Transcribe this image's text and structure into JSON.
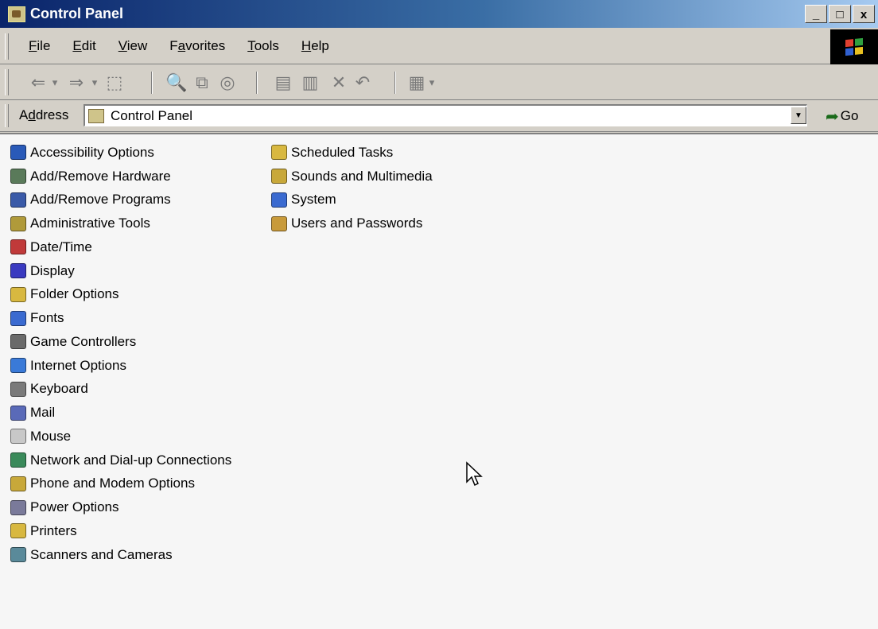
{
  "window": {
    "title": "Control Panel",
    "buttons": {
      "minimize": "_",
      "maximize": "□",
      "close": "x"
    }
  },
  "menubar": {
    "items": [
      {
        "label": "File",
        "accel": "F",
        "rest": "ile"
      },
      {
        "label": "Edit",
        "accel": "E",
        "rest": "dit"
      },
      {
        "label": "View",
        "accel": "V",
        "rest": "iew"
      },
      {
        "label": "Favorites",
        "pre": "F",
        "accel": "a",
        "rest": "vorites"
      },
      {
        "label": "Tools",
        "accel": "T",
        "rest": "ools"
      },
      {
        "label": "Help",
        "accel": "H",
        "rest": "elp"
      }
    ]
  },
  "toolbar": {
    "buttons": [
      {
        "name": "back-icon",
        "glyph": "⇐"
      },
      {
        "name": "back-dropdown-icon",
        "glyph": "▾"
      },
      {
        "name": "forward-icon",
        "glyph": "⇒"
      },
      {
        "name": "forward-dropdown-icon",
        "glyph": "▾"
      },
      {
        "name": "up-folder-icon",
        "glyph": "⬚"
      },
      {
        "name": "search-icon",
        "glyph": "🔍"
      },
      {
        "name": "folders-icon",
        "glyph": "⧉"
      },
      {
        "name": "history-icon",
        "glyph": "◎"
      },
      {
        "name": "move-to-icon",
        "glyph": "▤"
      },
      {
        "name": "copy-to-icon",
        "glyph": "▥"
      },
      {
        "name": "delete-icon",
        "glyph": "✕"
      },
      {
        "name": "undo-icon",
        "glyph": "↶"
      },
      {
        "name": "views-icon",
        "glyph": "▦"
      },
      {
        "name": "views-dropdown-icon",
        "glyph": "▾"
      }
    ]
  },
  "address": {
    "label_pre": "A",
    "label_accel": "d",
    "label_rest": "dress",
    "value": "Control Panel",
    "go_label": "Go"
  },
  "items_col1": [
    {
      "label": "Accessibility Options",
      "icon": "accessibility-icon",
      "color": "#2a5ab8"
    },
    {
      "label": "Add/Remove Hardware",
      "icon": "hardware-icon",
      "color": "#5a7a5a"
    },
    {
      "label": "Add/Remove Programs",
      "icon": "programs-icon",
      "color": "#3a5aa8"
    },
    {
      "label": "Administrative Tools",
      "icon": "admin-tools-icon",
      "color": "#b09a3a"
    },
    {
      "label": "Date/Time",
      "icon": "calendar-clock-icon",
      "color": "#c03a3a"
    },
    {
      "label": "Display",
      "icon": "display-icon",
      "color": "#3a3ac0"
    },
    {
      "label": "Folder Options",
      "icon": "folder-options-icon",
      "color": "#d8b840"
    },
    {
      "label": "Fonts",
      "icon": "fonts-icon",
      "color": "#3a6ad0"
    },
    {
      "label": "Game Controllers",
      "icon": "joystick-icon",
      "color": "#6a6a6a"
    },
    {
      "label": "Internet Options",
      "icon": "globe-icon",
      "color": "#3a7ad8"
    },
    {
      "label": "Keyboard",
      "icon": "keyboard-icon",
      "color": "#7a7a7a"
    },
    {
      "label": "Mail",
      "icon": "mail-icon",
      "color": "#5a6ab8"
    },
    {
      "label": "Mouse",
      "icon": "mouse-icon",
      "color": "#c8c8c8"
    },
    {
      "label": "Network and Dial-up Connections",
      "icon": "network-icon",
      "color": "#3a8a5a"
    },
    {
      "label": "Phone and Modem Options",
      "icon": "phone-icon",
      "color": "#c8a83a"
    },
    {
      "label": "Power Options",
      "icon": "power-icon",
      "color": "#7a7a9a"
    },
    {
      "label": "Printers",
      "icon": "printer-folder-icon",
      "color": "#d8b840"
    },
    {
      "label": "Scanners and Cameras",
      "icon": "scanner-icon",
      "color": "#5a8a9a"
    }
  ],
  "items_col2": [
    {
      "label": "Scheduled Tasks",
      "icon": "scheduled-tasks-icon",
      "color": "#d8b840"
    },
    {
      "label": "Sounds and Multimedia",
      "icon": "speaker-icon",
      "color": "#c8a83a"
    },
    {
      "label": "System",
      "icon": "computer-icon",
      "color": "#3a6ad0"
    },
    {
      "label": "Users and Passwords",
      "icon": "users-icon",
      "color": "#c89a3a"
    }
  ]
}
